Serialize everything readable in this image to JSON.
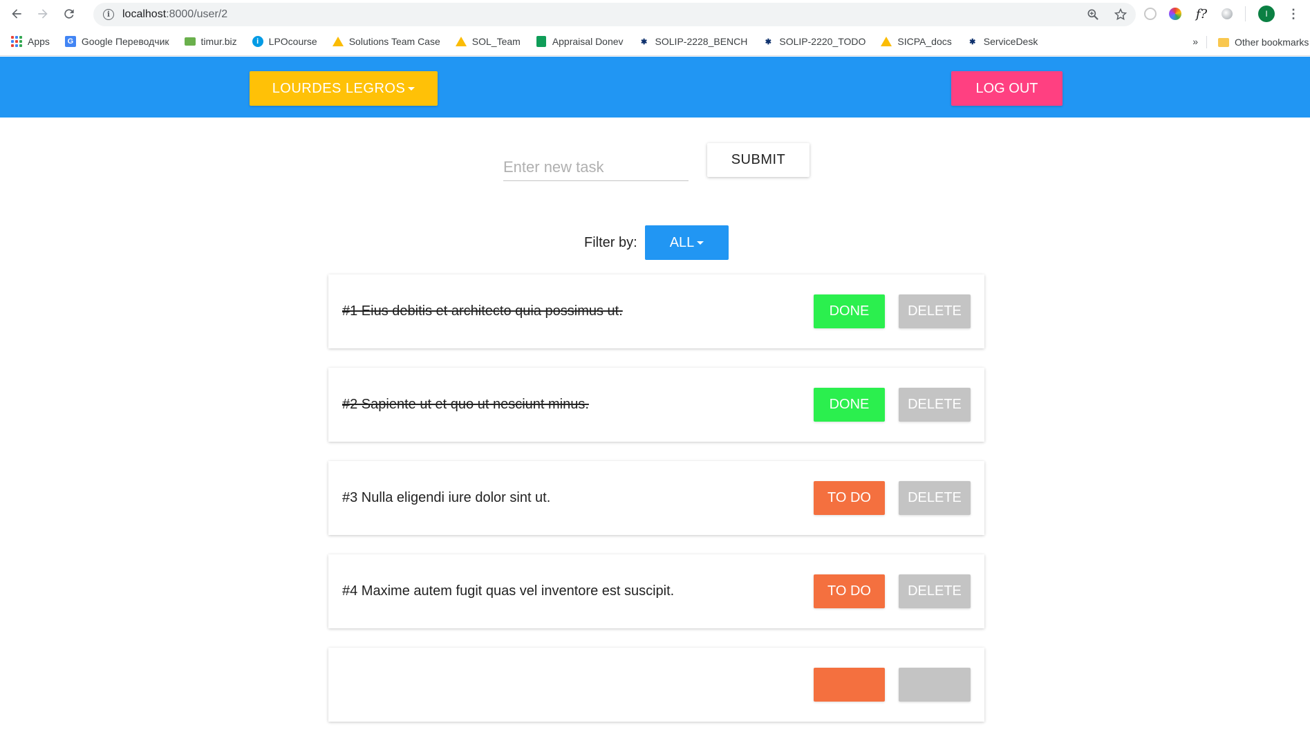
{
  "browser": {
    "url_host": "localhost",
    "url_path": ":8000/user/2",
    "avatar_letter": "I",
    "bookmarks": [
      {
        "label": "Apps",
        "icon": "apps-grid-icon"
      },
      {
        "label": "Google Переводчик",
        "icon": "google-translate-icon"
      },
      {
        "label": "timur.biz",
        "icon": "mail-icon"
      },
      {
        "label": "LPOcourse",
        "icon": "circle-icon"
      },
      {
        "label": "Solutions Team Case",
        "icon": "google-drive-icon"
      },
      {
        "label": "SOL_Team",
        "icon": "google-drive-icon"
      },
      {
        "label": "Appraisal Donev",
        "icon": "google-sheets-icon"
      },
      {
        "label": "SOLIP-2228_BENCH",
        "icon": "jira-icon"
      },
      {
        "label": "SOLIP-2220_TODO",
        "icon": "jira-icon"
      },
      {
        "label": "SICPA_docs",
        "icon": "google-drive-icon"
      },
      {
        "label": "ServiceDesk",
        "icon": "jira-icon"
      }
    ],
    "more_label": "»",
    "other_bookmarks": "Other bookmarks"
  },
  "header": {
    "user_label": "LOURDES LEGROS",
    "logout_label": "LOG OUT",
    "colors": {
      "bar": "#2196f3",
      "user": "#ffc107",
      "logout": "#ff4081"
    }
  },
  "new_task": {
    "placeholder": "Enter new task",
    "submit_label": "SUBMIT"
  },
  "filter": {
    "label": "Filter by:",
    "value": "ALL"
  },
  "tasks": [
    {
      "text": "#1 Eius debitis et architecto quia possimus ut.",
      "status": "DONE",
      "delete": "DELETE"
    },
    {
      "text": "#2 Sapiente ut et quo ut nesciunt minus.",
      "status": "DONE",
      "delete": "DELETE"
    },
    {
      "text": "#3 Nulla eligendi iure dolor sint ut.",
      "status": "TO DO",
      "delete": "DELETE"
    },
    {
      "text": "#4 Maxime autem fugit quas vel inventore est suscipit.",
      "status": "TO DO",
      "delete": "DELETE"
    }
  ],
  "status_colors": {
    "DONE": "#2bef4e",
    "TO DO": "#f4703f"
  }
}
